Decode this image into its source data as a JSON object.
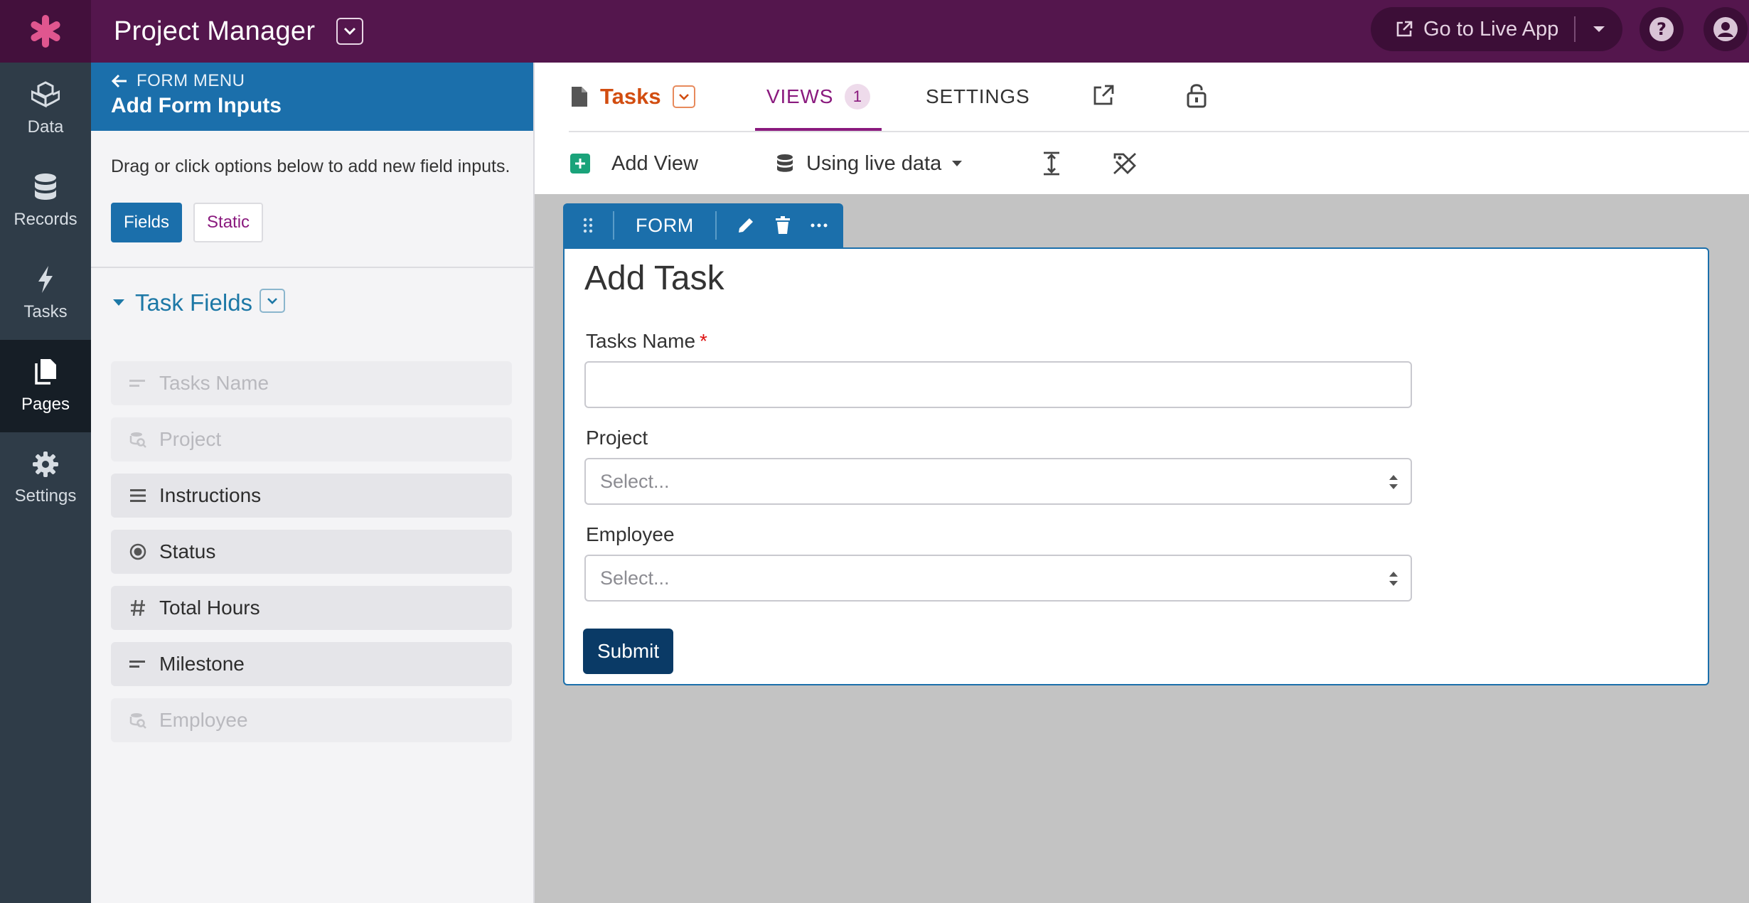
{
  "topbar": {
    "app_title": "Project Manager",
    "live_button_label": "Go to Live App",
    "brand_color": "#54164d",
    "logo_color": "#e0568f"
  },
  "leftnav": {
    "items": [
      {
        "label": "Data",
        "icon": "cubes-icon",
        "active": false
      },
      {
        "label": "Records",
        "icon": "database-icon",
        "active": false
      },
      {
        "label": "Tasks",
        "icon": "bolt-icon",
        "active": false
      },
      {
        "label": "Pages",
        "icon": "pages-icon",
        "active": true
      },
      {
        "label": "Settings",
        "icon": "gear-icon",
        "active": false
      }
    ]
  },
  "panel": {
    "back_label": "FORM MENU",
    "title": "Add Form Inputs",
    "description": "Drag or click options below to add new field inputs.",
    "tab_fields": "Fields",
    "tab_static": "Static",
    "group_title": "Task Fields",
    "fields": [
      {
        "label": "Tasks Name",
        "icon": "short-text-icon",
        "enabled": false
      },
      {
        "label": "Project",
        "icon": "connection-icon",
        "enabled": false
      },
      {
        "label": "Instructions",
        "icon": "paragraph-icon",
        "enabled": true
      },
      {
        "label": "Status",
        "icon": "radio-icon",
        "enabled": true
      },
      {
        "label": "Total Hours",
        "icon": "hash-icon",
        "enabled": true
      },
      {
        "label": "Milestone",
        "icon": "short-text-icon",
        "enabled": true
      },
      {
        "label": "Employee",
        "icon": "connection-icon",
        "enabled": false
      }
    ]
  },
  "main": {
    "page_tab": "Tasks",
    "views_tab": "VIEWS",
    "views_count": "1",
    "settings_tab": "SETTINGS",
    "add_view": "Add View",
    "data_source": "Using live data"
  },
  "form_view": {
    "toolbar_label": "FORM",
    "title": "Add Task",
    "fields": {
      "name_label": "Tasks Name",
      "required_mark": "*",
      "project_label": "Project",
      "project_placeholder": "Select...",
      "employee_label": "Employee",
      "employee_placeholder": "Select..."
    },
    "submit_label": "Submit"
  }
}
